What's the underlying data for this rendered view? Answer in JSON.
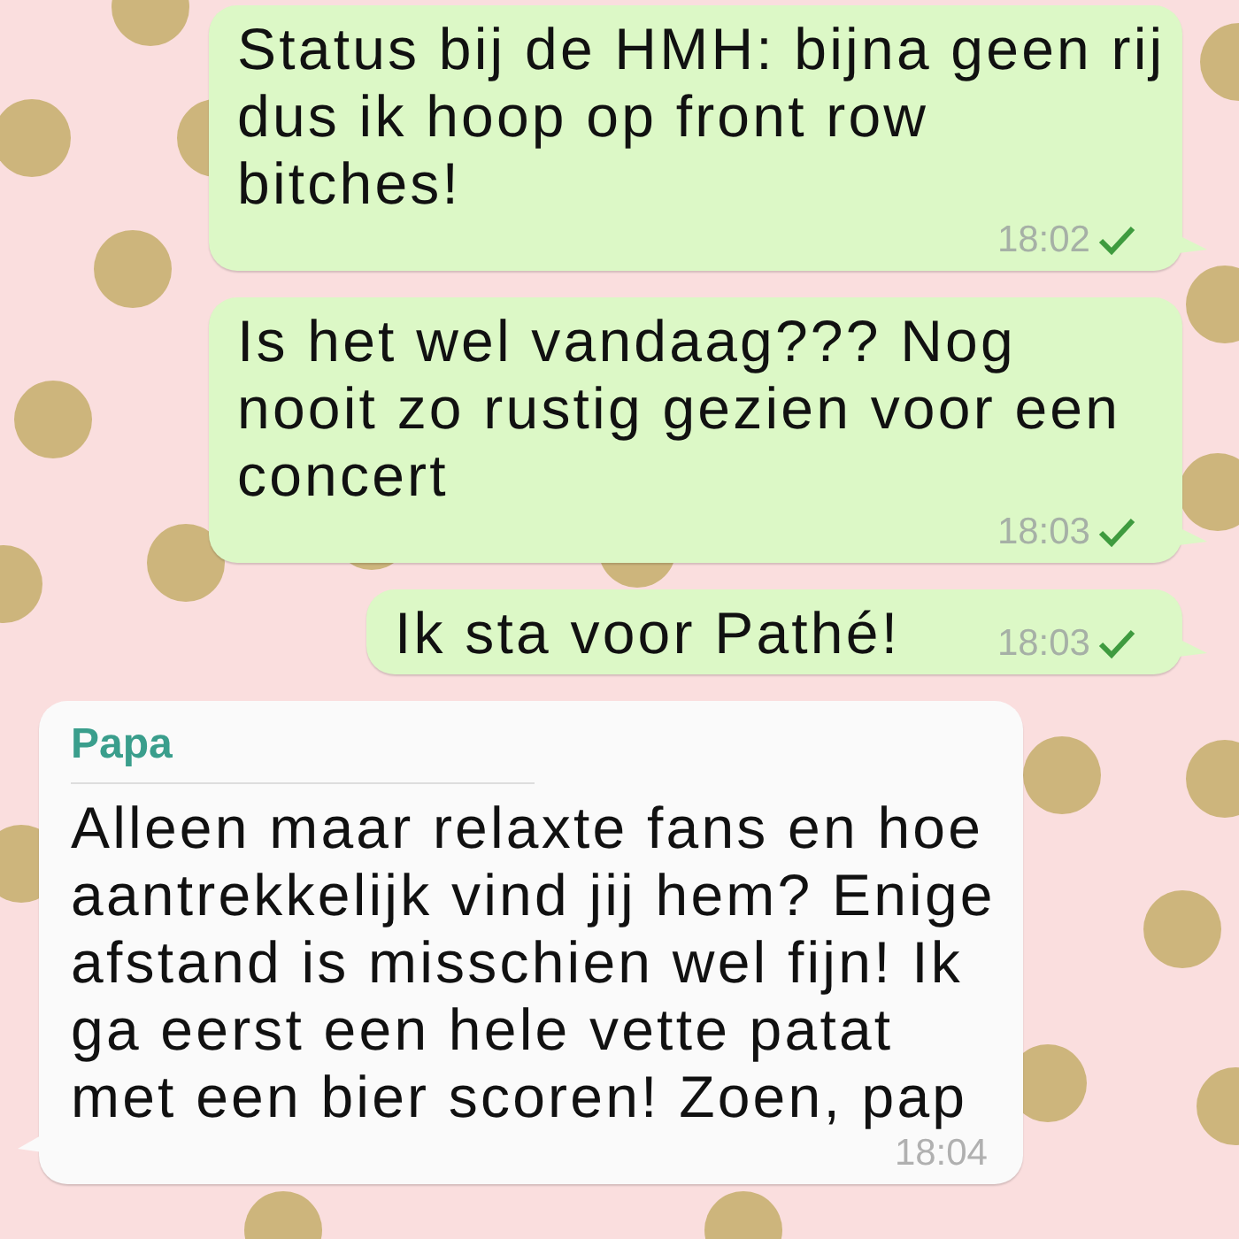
{
  "messages": [
    {
      "kind": "outgoing",
      "text": "Status bij de HMH: bijna geen rij dus ik hoop op front row bitches!",
      "time": "18:02",
      "delivered": true
    },
    {
      "kind": "outgoing",
      "text": "Is het wel vandaag??? Nog nooit zo rustig gezien voor een concert",
      "time": "18:03",
      "delivered": true
    },
    {
      "kind": "outgoing",
      "text": "Ik sta voor Pathé!",
      "time": "18:03",
      "delivered": true
    },
    {
      "kind": "incoming",
      "sender": "Papa",
      "text": "Alleen maar relaxte fans en hoe aantrekkelijk vind jij hem? Enige afstand is misschien wel fijn! Ik ga eerst een hele vette patat met een bier scoren! Zoen, pap",
      "time": "18:04"
    }
  ]
}
